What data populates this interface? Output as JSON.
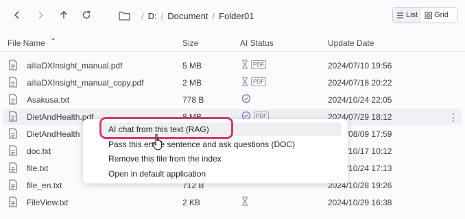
{
  "breadcrumb": [
    "D:",
    "Document",
    "Folder01"
  ],
  "view": {
    "list_label": "List",
    "grid_label": "Grid",
    "active": "List"
  },
  "columns": {
    "name": "File Name",
    "size": "Size",
    "ai_status": "AI Status",
    "update": "Update Date"
  },
  "files": [
    {
      "name": "ailiaDXInsight_manual.pdf",
      "size": "5 MB",
      "status": "pending",
      "badge": "PDF",
      "date": "2024/07/10 19:56"
    },
    {
      "name": "ailiaDXInsight_manual_copy.pdf",
      "size": "2 MB",
      "status": "pending",
      "badge": "PDF",
      "date": "2024/07/18 20:22"
    },
    {
      "name": "Asakusa.txt",
      "size": "778 B",
      "status": "done",
      "badge": "",
      "date": "2024/10/24 22:05"
    },
    {
      "name": "DietAndHealth.pdf",
      "size": "8 MB",
      "status": "done",
      "badge": "PDF",
      "date": "2024/07/29 18:12"
    },
    {
      "name": "DietAndHealth",
      "size": "",
      "status": "",
      "badge": "",
      "date": "2024/08/09 17:59"
    },
    {
      "name": "doc.txt",
      "size": "",
      "status": "",
      "badge": "",
      "date": "2024/10/17 10:12"
    },
    {
      "name": "file.txt",
      "size": "",
      "status": "",
      "badge": "",
      "date": "2024/10/24 17:13"
    },
    {
      "name": "file_en.txt",
      "size": "712 B",
      "status": "",
      "badge": "",
      "date": "2024/10/28 19:26"
    },
    {
      "name": "FileView.txt",
      "size": "2 KB",
      "status": "pending",
      "badge": "",
      "date": "2024/10/29 16:38"
    }
  ],
  "context_menu": {
    "items": [
      "AI chat from this text (RAG)",
      "Pass this entire sentence and ask questions (DOC)",
      "Remove this file from the index",
      "Open in default application"
    ]
  },
  "colors": {
    "accent_ring": "#d23a68",
    "status_done": "#6f6cd9"
  },
  "icons": {
    "back": "arrow-left-icon",
    "forward": "arrow-right-icon",
    "up": "arrow-up-icon",
    "refresh": "refresh-icon",
    "folder": "folder-icon",
    "file": "file-icon",
    "pending": "hourglass-icon",
    "done": "check-circle-icon",
    "more": "kebab-icon"
  }
}
